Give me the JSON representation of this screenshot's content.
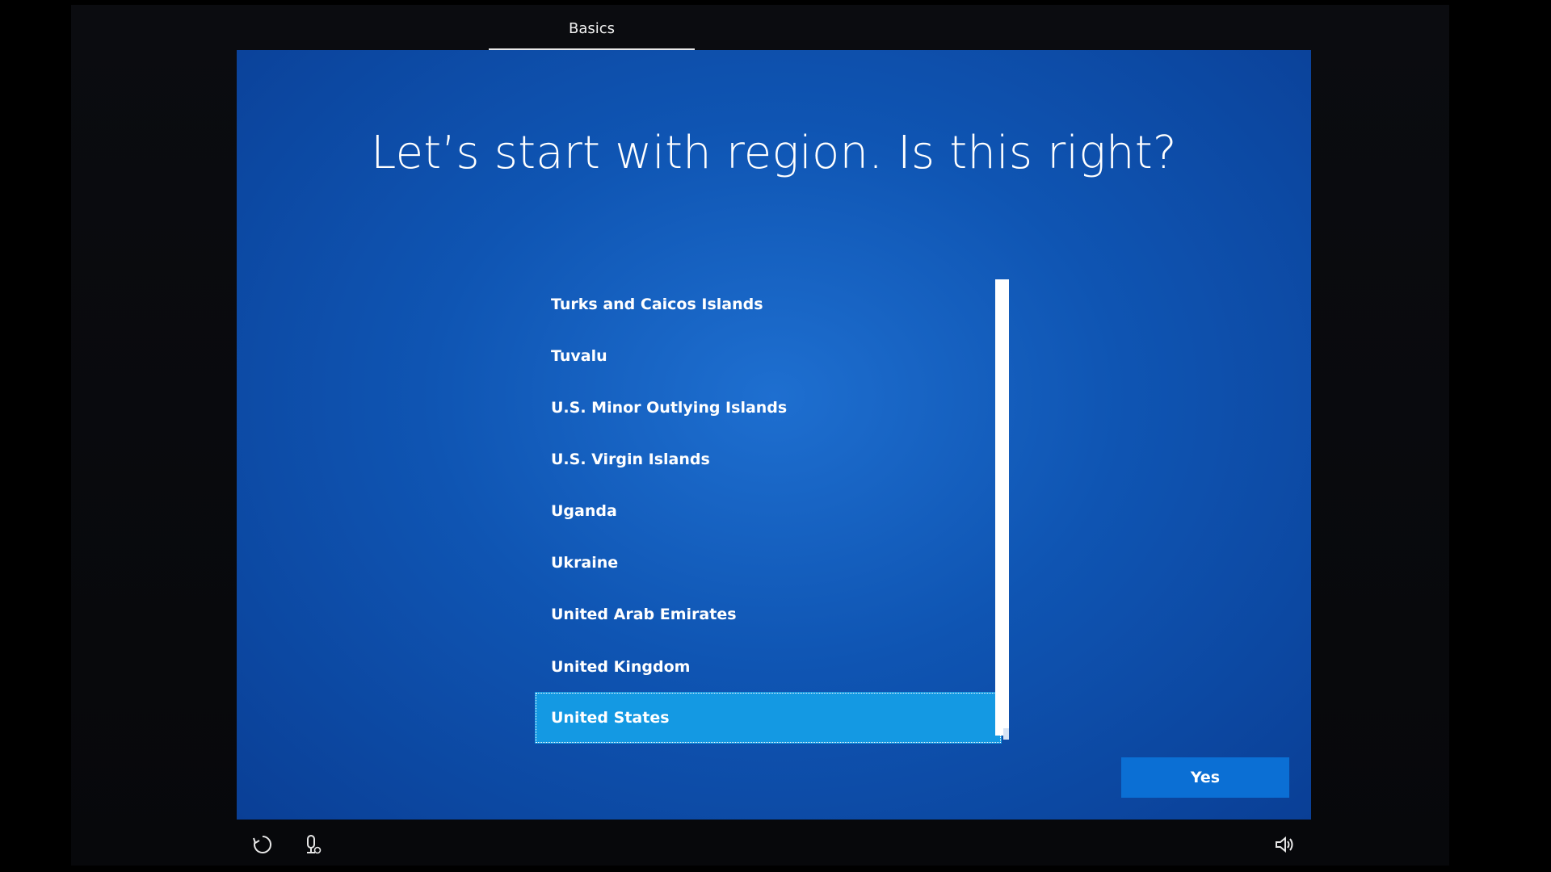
{
  "header": {
    "tab_label": "Basics"
  },
  "main": {
    "heading": "Let’s start with region. Is this right?",
    "regions": [
      "Turks and Caicos Islands",
      "Tuvalu",
      "U.S. Minor Outlying Islands",
      "U.S. Virgin Islands",
      "Uganda",
      "Ukraine",
      "United Arab Emirates",
      "United Kingdom",
      "United States"
    ],
    "selected_region": "United States",
    "confirm_label": "Yes"
  },
  "footer": {
    "icons": [
      "ease-of-access-icon",
      "microphone-icon",
      "volume-icon"
    ]
  },
  "colors": {
    "screen_blue": "#0f55b3",
    "selected_item": "#1499e3",
    "yes_button": "#0b6fd4",
    "text": "#ffffff"
  }
}
